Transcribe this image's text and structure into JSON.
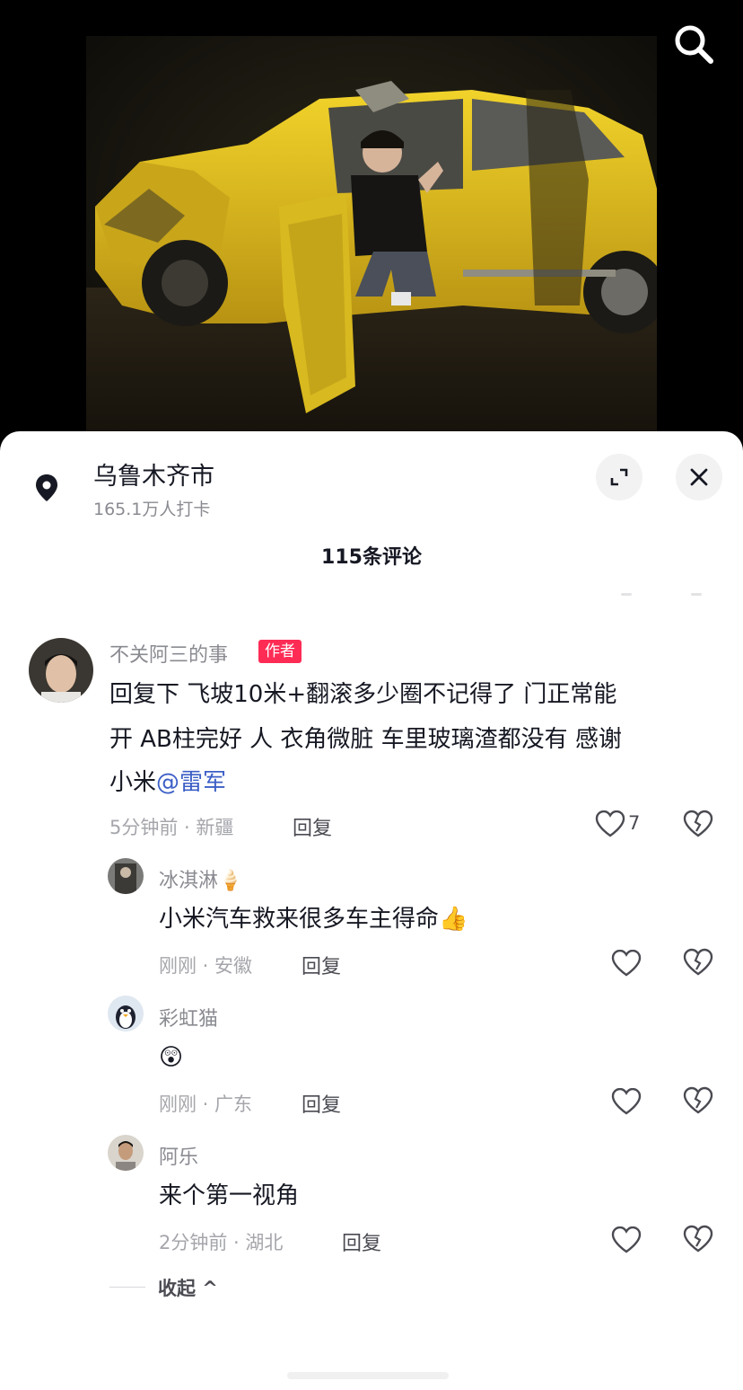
{
  "location": {
    "title": "乌鲁木齐市",
    "checkins": "165.1万人打卡"
  },
  "comments_header": "115条评论",
  "comments": [
    {
      "user": "不关阿三的事",
      "badge": "作者",
      "text_line1": "回复下 飞坡10米+翻滚多少圈不记得了 门正常能",
      "text_line2": "开 AB柱完好 人 衣角微脏 车里玻璃渣都没有 感谢",
      "text_line3_prefix": "小米",
      "mention": "@雷军",
      "meta": "5分钟前 · 新疆",
      "reply": "回复",
      "likes": "7"
    },
    {
      "user": "冰淇淋🍦",
      "text": "小米汽车救来很多车主得命👍",
      "meta": "刚刚 · 安徽",
      "reply": "回复"
    },
    {
      "user": "彩虹猫",
      "text": "😲",
      "meta": "刚刚 · 广东",
      "reply": "回复"
    },
    {
      "user": "阿乐",
      "text": "来个第一视角",
      "meta": "2分钟前 · 湖北",
      "reply": "回复"
    }
  ],
  "collapse_label": "收起 ^",
  "colors": {
    "author_badge": "#fe2c55",
    "mention": "#3c5fc6",
    "car_yellow": "#e3c21b"
  },
  "icons": [
    "search-icon",
    "location-pin-icon",
    "expand-icon",
    "close-icon",
    "heart-icon",
    "broken-heart-icon"
  ]
}
